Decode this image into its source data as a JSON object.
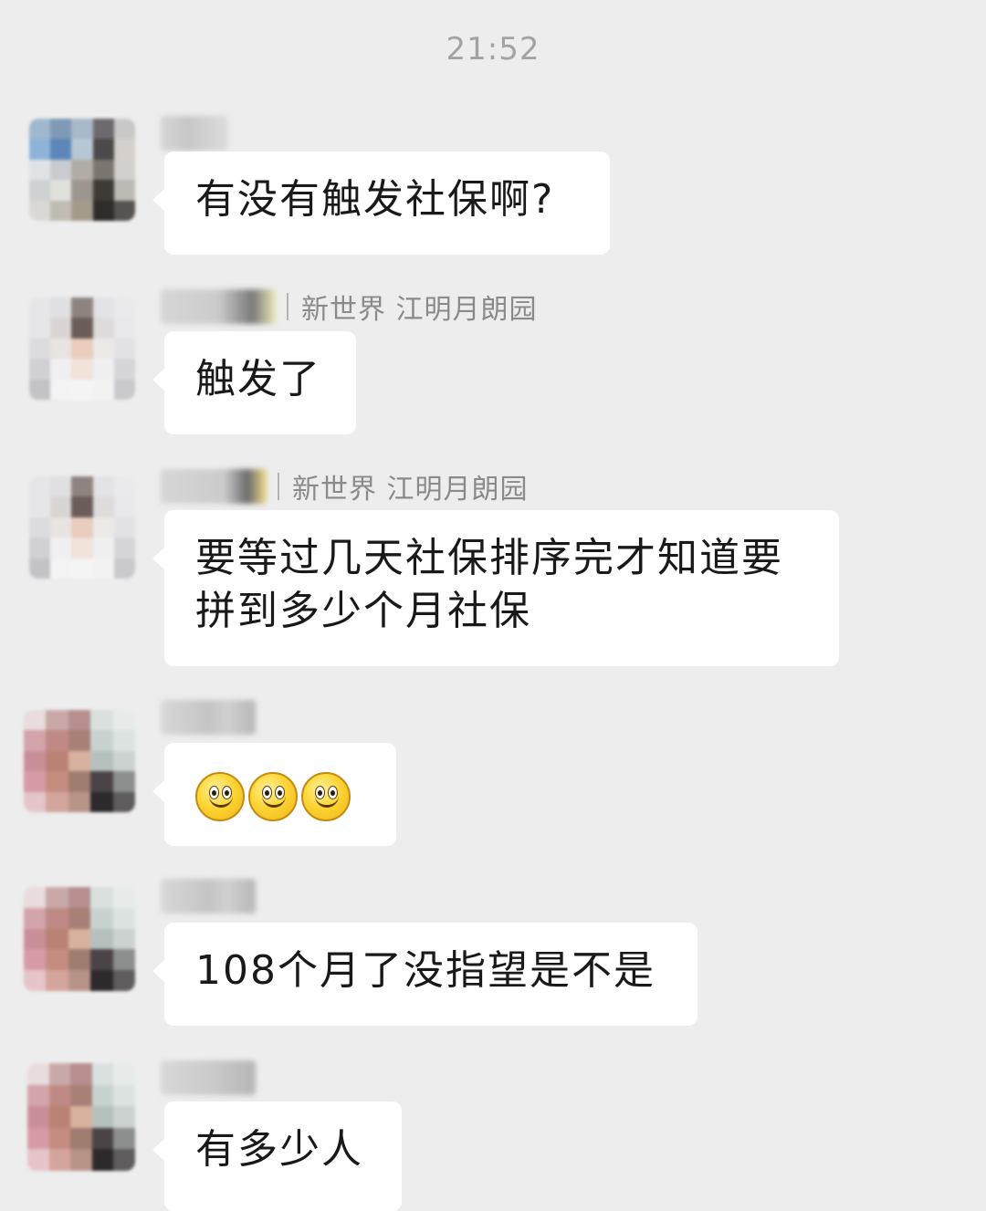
{
  "chat": {
    "timestamp": "21:52",
    "messages": [
      {
        "group_tag": "",
        "text": "有没有触发社保啊?"
      },
      {
        "group_tag": "新世界 江明月朗园",
        "text": "触发了"
      },
      {
        "group_tag": "新世界 江明月朗园",
        "line1": "要等过几天社保排序完才知道要",
        "line2": "拼到多少个月社保"
      },
      {
        "group_tag": "",
        "emojis": [
          "smiley-emoji",
          "smiley-emoji",
          "smiley-emoji"
        ]
      },
      {
        "group_tag": "",
        "text": "108个月了没指望是不是"
      },
      {
        "group_tag": "",
        "text": "有多少人"
      }
    ]
  },
  "colors": {
    "background": "#ededed",
    "bubble": "#ffffff",
    "timestamp": "#a3a3a3",
    "group_tag": "#8a8a8a",
    "message_text": "#191919"
  }
}
